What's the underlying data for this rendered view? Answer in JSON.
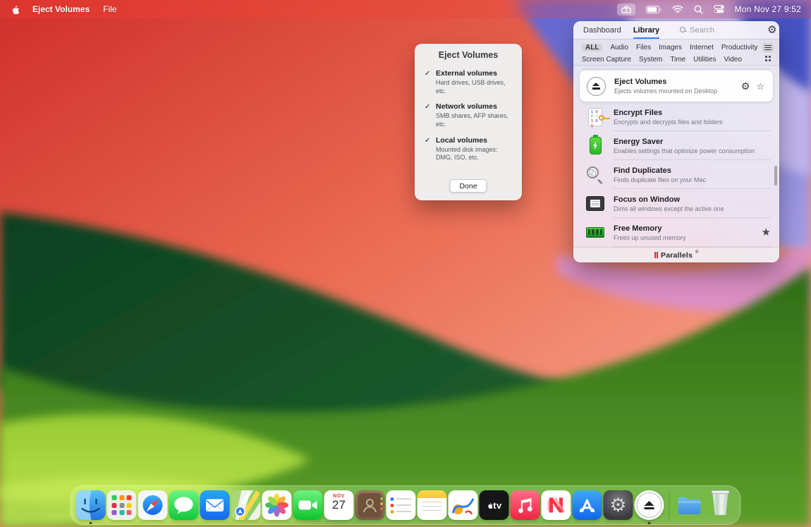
{
  "icons": {
    "checkmark": "✓",
    "gear": "⚙",
    "star_outline": "☆",
    "star_filled": "★",
    "registered": "®"
  },
  "menu_bar": {
    "app_name": "Eject Volumes",
    "menu_file": "File",
    "clock": "Mon Nov 27 9:52",
    "status_icons": [
      "parallels-toolbox",
      "battery",
      "wifi",
      "spotlight",
      "control-center"
    ]
  },
  "dialog": {
    "title": "Eject Volumes",
    "options": [
      {
        "checked": true,
        "label": "External volumes",
        "description": "Hard drives, USB drives, etc."
      },
      {
        "checked": true,
        "label": "Network volumes",
        "description": "SMB shares, AFP shares, etc."
      },
      {
        "checked": true,
        "label": "Local volumes",
        "description": "Mounted disk images: DMG, ISO, etc."
      }
    ],
    "done_label": "Done"
  },
  "panel": {
    "tabs": [
      {
        "label": "Dashboard",
        "active": false
      },
      {
        "label": "Library",
        "active": true
      }
    ],
    "search_placeholder": "Search",
    "active_filter": "ALL",
    "filters_row1": [
      "ALL",
      "Audio",
      "Files",
      "Images",
      "Internet",
      "Productivity"
    ],
    "filters_row2": [
      "Screen Capture",
      "System",
      "Time",
      "Utilities",
      "Video"
    ],
    "view_mode": "list",
    "tools": [
      {
        "title": "Eject Volumes",
        "subtitle": "Ejects volumes mounted on Desktop",
        "icon": "eject-circle",
        "selected": true
      },
      {
        "title": "Encrypt Files",
        "subtitle": "Encrypts and decrypts files and folders",
        "icon": "binary-document-key"
      },
      {
        "title": "Energy Saver",
        "subtitle": "Enables settings that optimize power consumption",
        "icon": "green-battery-bolt"
      },
      {
        "title": "Find Duplicates",
        "subtitle": "Finds duplicate files on your Mac",
        "icon": "magnifier-documents"
      },
      {
        "title": "Focus on Window",
        "subtitle": "Dims all windows except the active one",
        "icon": "window-monitor"
      },
      {
        "title": "Free Memory",
        "subtitle": "Frees up unused memory",
        "icon": "ram-module",
        "favorite": true
      }
    ],
    "brand": "Parallels"
  },
  "dock": {
    "items": [
      {
        "label": "Finder",
        "running": true
      },
      {
        "label": "Launchpad"
      },
      {
        "label": "Safari"
      },
      {
        "label": "Messages"
      },
      {
        "label": "Mail"
      },
      {
        "label": "Maps"
      },
      {
        "label": "Photos"
      },
      {
        "label": "FaceTime"
      },
      {
        "label": "Calendar",
        "month": "NOV",
        "day": "27"
      },
      {
        "label": "Contacts"
      },
      {
        "label": "Reminders"
      },
      {
        "label": "Notes"
      },
      {
        "label": "Freeform"
      },
      {
        "label": "TV",
        "text": "tv"
      },
      {
        "label": "Music"
      },
      {
        "label": "News"
      },
      {
        "label": "App Store"
      },
      {
        "label": "System Settings"
      },
      {
        "label": "Eject Volumes",
        "running": true
      },
      {
        "label": "Downloads"
      },
      {
        "label": "Trash"
      }
    ]
  },
  "colors": {
    "accent_blue": "#3d7df0",
    "parallels_red": "#e3242b",
    "menubar_tint": "rgba(210,80,70,0.30)"
  }
}
